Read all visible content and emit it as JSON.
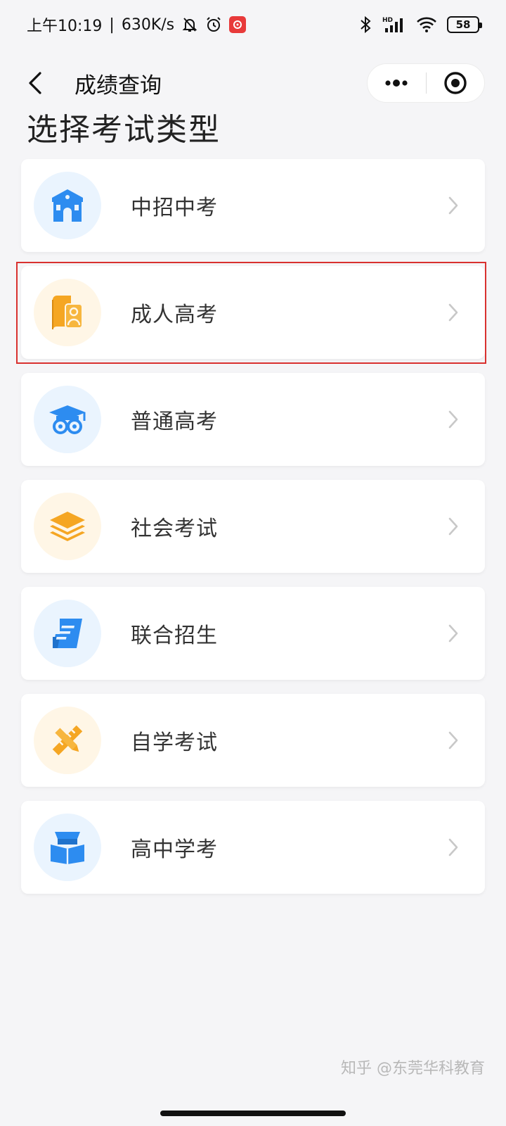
{
  "status_bar": {
    "time": "上午10:19",
    "separator": "|",
    "net_speed": "630K/s",
    "signal_label": "HD",
    "battery": "58"
  },
  "nav": {
    "title": "成绩查询"
  },
  "page": {
    "heading": "选择考试类型"
  },
  "exam_types": [
    {
      "label": "中招中考",
      "icon": "building-icon",
      "tone": "blue",
      "highlighted": false
    },
    {
      "label": "成人高考",
      "icon": "book-person-icon",
      "tone": "orange",
      "highlighted": true
    },
    {
      "label": "普通高考",
      "icon": "graduation-cap-icon",
      "tone": "blue",
      "highlighted": false
    },
    {
      "label": "社会考试",
      "icon": "layers-icon",
      "tone": "orange",
      "highlighted": false
    },
    {
      "label": "联合招生",
      "icon": "document-scroll-icon",
      "tone": "blue",
      "highlighted": false
    },
    {
      "label": "自学考试",
      "icon": "ruler-pencil-icon",
      "tone": "orange",
      "highlighted": false
    },
    {
      "label": "高中学考",
      "icon": "reading-book-icon",
      "tone": "blue",
      "highlighted": false
    }
  ],
  "colors": {
    "blue_icon": "#2d8cf0",
    "orange_icon": "#f5a623",
    "highlight_border": "#d9312f"
  },
  "watermark": "知乎 @东莞华科教育"
}
